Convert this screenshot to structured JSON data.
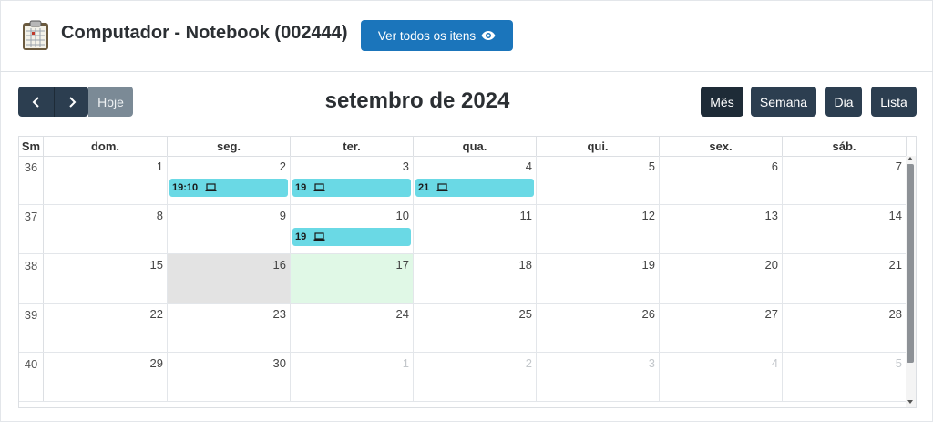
{
  "header": {
    "title": "Computador - Notebook (002444)",
    "view_all_label": "Ver todos os itens",
    "icons": {
      "app": "calendar-clipboard-icon",
      "view_all": "eye-icon"
    }
  },
  "toolbar": {
    "today_label": "Hoje",
    "month_title": "setembro de 2024",
    "views": {
      "month": "Mês",
      "week": "Semana",
      "day": "Dia",
      "list": "Lista"
    },
    "active_view": "Mês"
  },
  "calendar": {
    "week_header": "Sm",
    "day_headers": [
      "dom.",
      "seg.",
      "ter.",
      "qua.",
      "qui.",
      "sex.",
      "sáb."
    ],
    "weeks": [
      {
        "number": "36",
        "days": [
          "1",
          "2",
          "3",
          "4",
          "5",
          "6",
          "7"
        ]
      },
      {
        "number": "37",
        "days": [
          "8",
          "9",
          "10",
          "11",
          "12",
          "13",
          "14"
        ]
      },
      {
        "number": "38",
        "days": [
          "15",
          "16",
          "17",
          "18",
          "19",
          "20",
          "21"
        ]
      },
      {
        "number": "39",
        "days": [
          "22",
          "23",
          "24",
          "25",
          "26",
          "27",
          "28"
        ]
      },
      {
        "number": "40",
        "days": [
          "29",
          "30",
          "1",
          "2",
          "3",
          "4",
          "5"
        ]
      }
    ],
    "events": [
      {
        "week": 0,
        "day": 1,
        "time": "19:10",
        "icon": "laptop-icon"
      },
      {
        "week": 0,
        "day": 2,
        "time": "19",
        "icon": "laptop-icon"
      },
      {
        "week": 0,
        "day": 3,
        "time": "21",
        "icon": "laptop-icon"
      },
      {
        "week": 1,
        "day": 2,
        "time": "19",
        "icon": "laptop-icon"
      }
    ],
    "today": {
      "week": 2,
      "day": 2
    },
    "colors": {
      "event": "#6ad9e5",
      "today": "#e0f8e6",
      "highlight": "#e3e3e3",
      "primary": "#2c3e50",
      "brand": "#1b75bb"
    }
  }
}
